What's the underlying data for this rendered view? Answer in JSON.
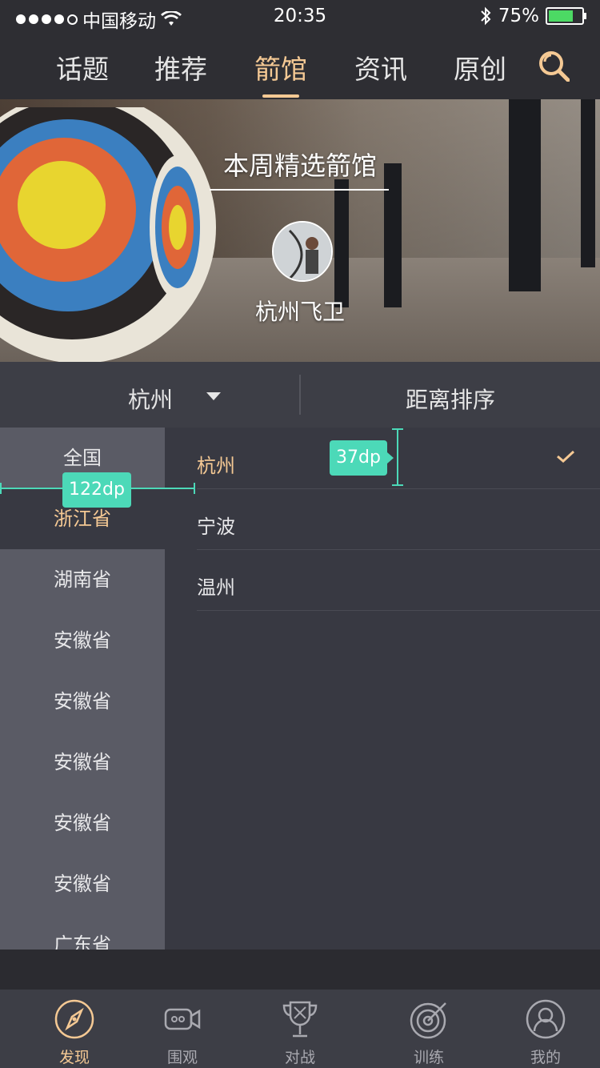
{
  "status": {
    "carrier": "中国移动",
    "time": "20:35",
    "battery": "75%"
  },
  "nav": {
    "tabs": [
      "话题",
      "推荐",
      "箭馆",
      "资讯",
      "原创"
    ],
    "active_index": 2
  },
  "banner": {
    "title": "本周精选箭馆",
    "venue_name": "杭州飞卫"
  },
  "filter": {
    "city": "杭州",
    "sort": "距离排序"
  },
  "provinces": [
    "全国",
    "浙江省",
    "湖南省",
    "安徽省",
    "安徽省",
    "安徽省",
    "安徽省",
    "安徽省",
    "广东省"
  ],
  "selected_province_index": 1,
  "cities": [
    "杭州",
    "宁波",
    "温州"
  ],
  "selected_city_index": 0,
  "annotations": {
    "width_label": "122dp",
    "height_label": "37dp"
  },
  "tabbar": {
    "items": [
      "发现",
      "围观",
      "对战",
      "训练",
      "我的"
    ],
    "active_index": 0
  },
  "colors": {
    "accent": "#f5c994",
    "annotation": "#4cd9b8"
  }
}
